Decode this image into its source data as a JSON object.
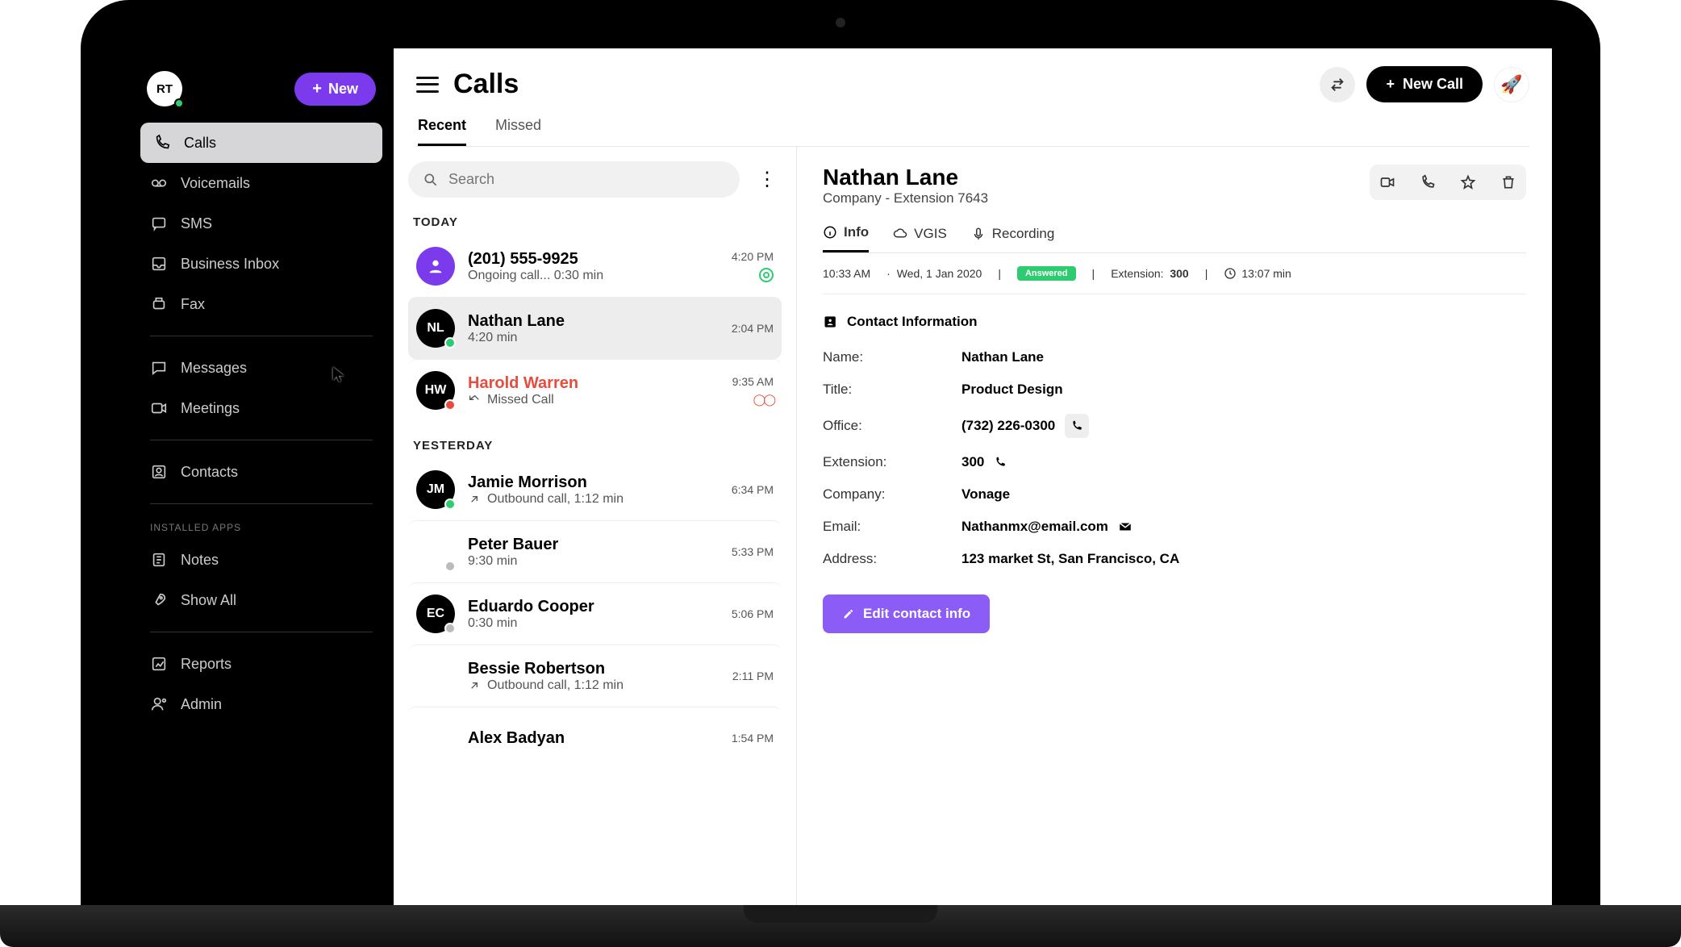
{
  "user_initials": "RT",
  "new_button": "New",
  "nav": {
    "calls": "Calls",
    "voicemails": "Voicemails",
    "sms": "SMS",
    "business_inbox": "Business Inbox",
    "fax": "Fax",
    "messages": "Messages",
    "meetings": "Meetings",
    "contacts": "Contacts",
    "installed_apps_caption": "INSTALLED APPS",
    "notes": "Notes",
    "show_all": "Show All",
    "reports": "Reports",
    "admin": "Admin"
  },
  "main": {
    "title": "Calls",
    "newcall_button": "New Call",
    "tabs": {
      "recent": "Recent",
      "missed": "Missed"
    },
    "search_placeholder": "Search"
  },
  "sections": {
    "today": "TODAY",
    "yesterday": "YESTERDAY"
  },
  "calls": {
    "c0": {
      "name": "(201) 555-9925",
      "sub": "Ongoing call... 0:30 min",
      "time": "4:20 PM"
    },
    "c1": {
      "initials": "NL",
      "name": "Nathan Lane",
      "sub": "4:20 min",
      "time": "2:04 PM"
    },
    "c2": {
      "initials": "HW",
      "name": "Harold Warren",
      "sub": "Missed Call",
      "time": "9:35 AM"
    },
    "c3": {
      "initials": "JM",
      "name": "Jamie Morrison",
      "sub": "Outbound call, 1:12 min",
      "time": "6:34 PM"
    },
    "c4": {
      "name": "Peter Bauer",
      "sub": "9:30 min",
      "time": "5:33 PM"
    },
    "c5": {
      "initials": "EC",
      "name": "Eduardo Cooper",
      "sub": "0:30 min",
      "time": "5:06 PM"
    },
    "c6": {
      "name": "Bessie Robertson",
      "sub": "Outbound call, 1:12 min",
      "time": "2:11 PM"
    },
    "c7": {
      "name": "Alex Badyan",
      "time": "1:54 PM"
    }
  },
  "detail": {
    "name": "Nathan Lane",
    "subtitle": "Company -  Extension 7643",
    "tabs": {
      "info": "Info",
      "vgis": "VGIS",
      "recording": "Recording"
    },
    "meta": {
      "time": "10:33 AM",
      "date": "Wed, 1 Jan 2020",
      "status": "Answered",
      "extension_label": "Extension:",
      "extension": "300",
      "duration": "13:07 min"
    },
    "ci_title": "Contact Information",
    "fields": {
      "name_l": "Name:",
      "name_v": "Nathan Lane",
      "title_l": "Title:",
      "title_v": "Product  Design",
      "office_l": "Office:",
      "office_v": "(732) 226-0300",
      "ext_l": "Extension:",
      "ext_v": "300",
      "company_l": "Company:",
      "company_v": "Vonage",
      "email_l": "Email:",
      "email_v": "Nathanmx@email.com",
      "address_l": "Address:",
      "address_v": "123 market St, San Francisco, CA"
    },
    "edit_button": "Edit contact info"
  }
}
